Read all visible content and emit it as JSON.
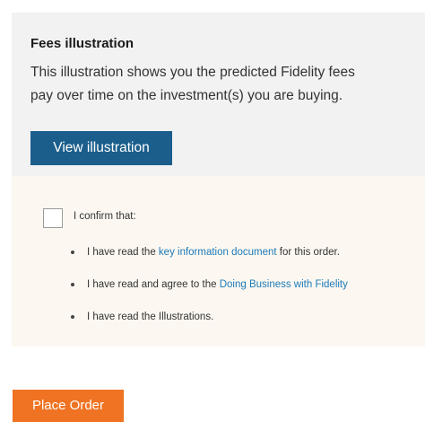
{
  "fees": {
    "title": "Fees illustration",
    "description_line1": "This illustration shows you the predicted Fidelity fees",
    "description_line2": "pay over time on the investment(s) you are buying.",
    "view_button": "View illustration"
  },
  "confirm": {
    "label": "I confirm that:",
    "checked": false,
    "items": [
      {
        "prefix": "I have read the ",
        "link": "key information document",
        "suffix": " for this order."
      },
      {
        "prefix": "I have read and agree to the ",
        "link": "Doing Business with Fidelity",
        "suffix": ""
      },
      {
        "prefix": "I have read the Illustrations.",
        "link": "",
        "suffix": ""
      }
    ]
  },
  "order": {
    "place_button": "Place Order"
  },
  "colors": {
    "view_button": "#1b5e8c",
    "place_button": "#ef7322",
    "link": "#1d7ab8",
    "fees_panel_bg": "#f2f2f2",
    "confirm_panel_bg": "#fcf8f1"
  }
}
